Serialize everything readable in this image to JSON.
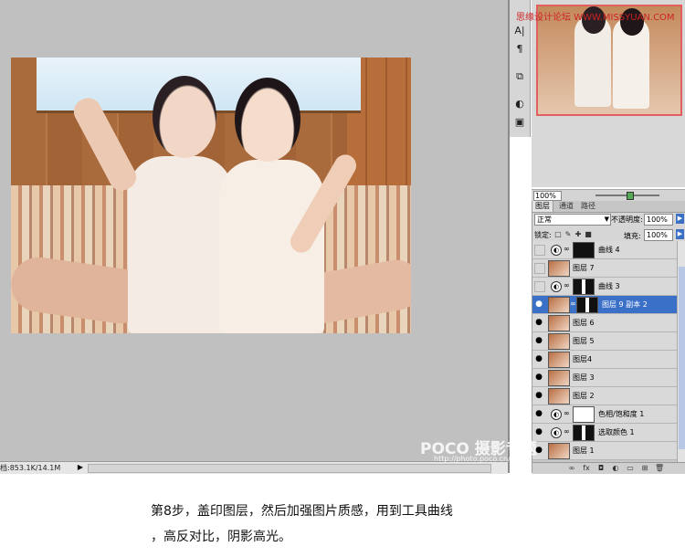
{
  "watermark": {
    "top": "思缘设计论坛  WWW.MISSYUAN.COM",
    "bottom_brand": "POCO 摄影专题",
    "bottom_url": "http://photo.poco.cn/"
  },
  "status_bar": {
    "doc_info": "档:853.1K/14.1M",
    "arrow": "▶"
  },
  "tools": [
    "A|",
    "¶",
    "⧉",
    "◐",
    "▣"
  ],
  "navigator": {
    "zoom_value": "100%"
  },
  "layers_panel": {
    "tabs": [
      "图层",
      "通道",
      "路径"
    ],
    "blend_mode": "正常",
    "opacity_label": "不透明度:",
    "opacity_value": "100%",
    "lock_label": "锁定:",
    "fill_label": "填充:",
    "fill_value": "100%",
    "layers": [
      {
        "name": "曲线 4",
        "kind": "adjustment",
        "mask": "black",
        "visible": false
      },
      {
        "name": "图层 7",
        "kind": "pixel",
        "visible": false
      },
      {
        "name": "曲线 3",
        "kind": "adjustment",
        "mask": "mixed",
        "visible": false
      },
      {
        "name": "图层 9 副本 2",
        "kind": "pixel-mask",
        "mask": "mixed",
        "visible": true,
        "selected": true
      },
      {
        "name": "图层 6",
        "kind": "pixel",
        "visible": true
      },
      {
        "name": "图层 5",
        "kind": "pixel",
        "visible": true
      },
      {
        "name": "图层4",
        "kind": "pixel",
        "visible": true
      },
      {
        "name": "图层 3",
        "kind": "pixel",
        "visible": true
      },
      {
        "name": "图层 2",
        "kind": "pixel",
        "visible": true
      },
      {
        "name": "色相/饱和度 1",
        "kind": "adjustment",
        "mask": "white",
        "visible": true
      },
      {
        "name": "选取颜色 1",
        "kind": "adjustment",
        "mask": "mixed",
        "visible": true
      },
      {
        "name": "图层 1",
        "kind": "pixel",
        "visible": true
      }
    ],
    "footer_icons": [
      "∞",
      "fx",
      "◘",
      "◐",
      "▭",
      "⊞",
      "🗑"
    ]
  },
  "caption": {
    "line1": "第8步，盖印图层，然后加强图片质感，用到工具曲线",
    "line2": "，高反对比，阴影高光。"
  }
}
